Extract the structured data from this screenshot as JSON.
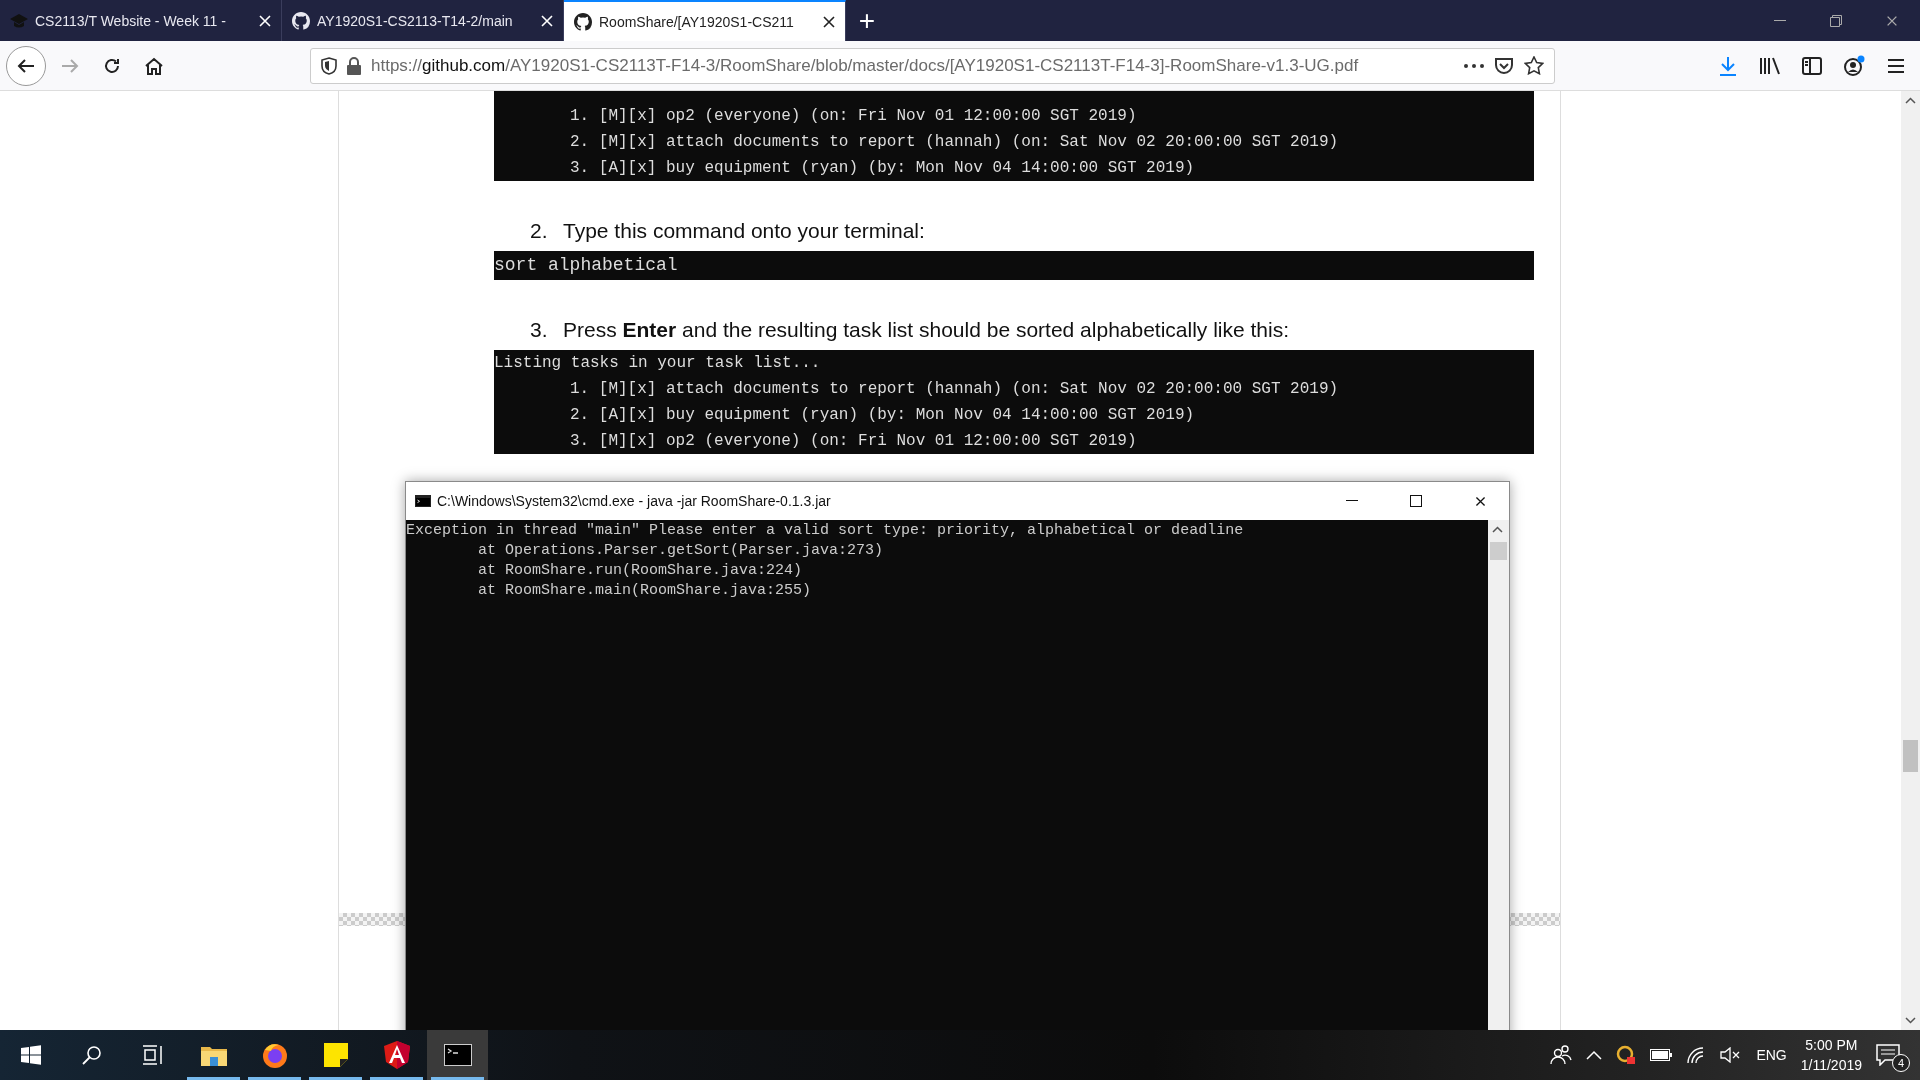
{
  "browser": {
    "tabs": [
      {
        "title": "CS2113/T Website - Week 11 -",
        "selected": false
      },
      {
        "title": "AY1920S1-CS2113-T14-2/main",
        "selected": false
      },
      {
        "title": "RoomShare/[AY1920S1-CS211",
        "selected": true
      }
    ],
    "new_tab": "+",
    "url": {
      "scheme": "https://",
      "domain": "github.com",
      "path": "/AY1920S1-CS2113T-F14-3/RoomShare/blob/master/docs/[AY1920S1-CS2113T-F14-3]-RoomShare-v1.3-UG.pdf"
    }
  },
  "document": {
    "blocks": [
      {
        "kind": "task_list",
        "items": [
          "1. [M][x] op2 (everyone) (on: Fri Nov 01 12:00:00 SGT 2019)",
          "2. [M][x] attach documents to report (hannah) (on: Sat Nov 02 20:00:00 SGT 2019)",
          "3. [A][x] buy equipment (ryan) (by: Mon Nov 04 14:00:00 SGT 2019)"
        ]
      },
      {
        "kind": "step",
        "number": "2.",
        "text": "Type this command onto your terminal:"
      },
      {
        "kind": "command",
        "text": "sort alphabetical"
      },
      {
        "kind": "step",
        "number": "3.",
        "text": "Press **Enter** and the resulting task list should be sorted alphabetically like this:"
      },
      {
        "kind": "task_list",
        "header": "Listing tasks in your task list...",
        "items": [
          "1. [M][x] attach documents to report (hannah) (on: Sat Nov 02 20:00:00 SGT 2019)",
          "2. [A][x] buy equipment (ryan) (by: Mon Nov 04 14:00:00 SGT 2019)",
          "3. [M][x] op2 (everyone) (on: Fri Nov 01 12:00:00 SGT 2019)"
        ]
      }
    ]
  },
  "console_window": {
    "title": "C:\\Windows\\System32\\cmd.exe - java  -jar RoomShare-0.1.3.jar",
    "message": "Exception in thread \"main\" Please enter a valid sort type: priority, alphabetical or deadline",
    "stack": [
      "at Operations.Parser.getSort(Parser.java:273)",
      "at RoomShare.run(RoomShare.java:224)",
      "at RoomShare.main(RoomShare.java:255)"
    ]
  },
  "taskbar": {
    "apps": [
      {
        "kind": "explorer",
        "running": true,
        "selected": false
      },
      {
        "kind": "firefox",
        "running": true,
        "selected": false
      },
      {
        "kind": "sticky",
        "running": true,
        "selected": false
      },
      {
        "kind": "angular",
        "running": true,
        "selected": false
      },
      {
        "kind": "console",
        "running": true,
        "selected": true
      }
    ],
    "tray": {
      "language": "ENG",
      "time": "5:00 PM",
      "date": "1/11/2019",
      "notifications": "4"
    }
  }
}
